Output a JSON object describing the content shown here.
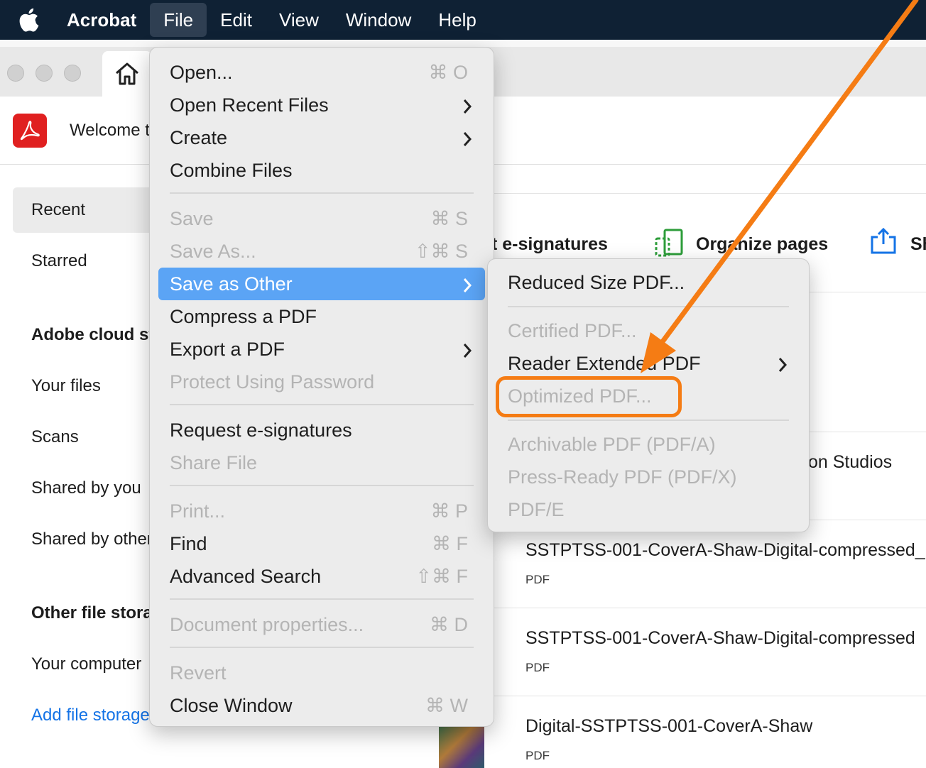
{
  "menubar": {
    "app_name": "Acrobat",
    "items": [
      "File",
      "Edit",
      "View",
      "Window",
      "Help"
    ]
  },
  "app": {
    "welcome_text": "Welcome t"
  },
  "sidebar": {
    "recent": "Recent",
    "starred": "Starred",
    "adobe_cloud_heading": "Adobe cloud st",
    "your_files": "Your files",
    "scans": "Scans",
    "shared_by_you": "Shared by you",
    "shared_by_others": "Shared by other",
    "other_storage_heading": "Other file storaç",
    "your_computer": "Your computer",
    "add_file_storage": "Add file storage"
  },
  "tools": {
    "request": "t e-signatures",
    "organize": "Organize pages",
    "share": "Sh"
  },
  "files": [
    {
      "name": "on Studios",
      "type": ""
    },
    {
      "name": "SSTPTSS-001-CoverA-Shaw-Digital-compressed_1",
      "type": "PDF"
    },
    {
      "name": "SSTPTSS-001-CoverA-Shaw-Digital-compressed",
      "type": "PDF"
    },
    {
      "name": "Digital-SSTPTSS-001-CoverA-Shaw",
      "type": "PDF"
    }
  ],
  "file_menu": {
    "open": {
      "label": "Open...",
      "shortcut": "⌘ O"
    },
    "open_recent": {
      "label": "Open Recent Files"
    },
    "create": {
      "label": "Create"
    },
    "combine": {
      "label": "Combine Files"
    },
    "save": {
      "label": "Save",
      "shortcut": "⌘ S"
    },
    "save_as": {
      "label": "Save As...",
      "shortcut": "⇧⌘ S"
    },
    "save_as_other": {
      "label": "Save as Other"
    },
    "compress": {
      "label": "Compress a PDF"
    },
    "export": {
      "label": "Export a PDF"
    },
    "protect": {
      "label": "Protect Using Password"
    },
    "request_esig": {
      "label": "Request e-signatures"
    },
    "share_file": {
      "label": "Share File"
    },
    "print": {
      "label": "Print...",
      "shortcut": "⌘ P"
    },
    "find": {
      "label": "Find",
      "shortcut": "⌘ F"
    },
    "advanced_search": {
      "label": "Advanced Search",
      "shortcut": "⇧⌘ F"
    },
    "doc_props": {
      "label": "Document properties...",
      "shortcut": "⌘ D"
    },
    "revert": {
      "label": "Revert"
    },
    "close_window": {
      "label": "Close Window",
      "shortcut": "⌘ W"
    }
  },
  "save_as_other_menu": {
    "reduced": "Reduced Size PDF...",
    "certified": "Certified PDF...",
    "reader_extended": "Reader Extended PDF",
    "optimized": "Optimized PDF...",
    "archivable": "Archivable PDF (PDF/A)",
    "press_ready": "Press-Ready PDF (PDF/X)",
    "pdfe": "PDF/E"
  },
  "colors": {
    "menubar": "#0f2134",
    "menu_highlight": "#5ba4f5",
    "annotation": "#f57c14",
    "acrobat_red": "#e02020",
    "link_blue": "#1473e6"
  }
}
